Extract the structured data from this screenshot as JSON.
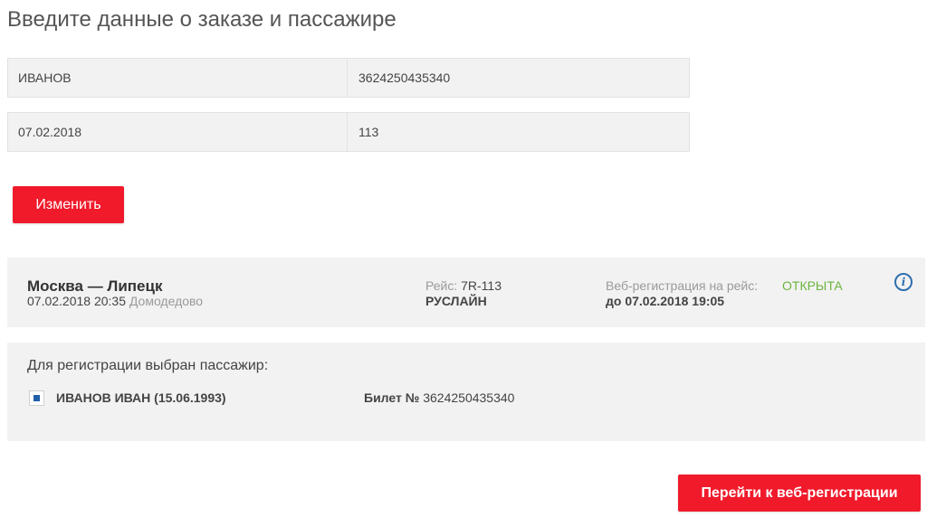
{
  "page": {
    "title": "Введите данные о заказе и пассажире"
  },
  "form": {
    "last_name": "ИВАНОВ",
    "ticket_number": "3624250435340",
    "date": "07.02.2018",
    "flight_number": "113"
  },
  "buttons": {
    "change_label": "Изменить",
    "go_label": "Перейти к веб-регистрации"
  },
  "flight": {
    "route": "Москва — Липецк",
    "departure_datetime": "07.02.2018 20:35",
    "airport": "Домодедово",
    "flight_label": "Рейс:",
    "flight_value": "7R-113",
    "carrier": "РУСЛАЙН",
    "registration_label": "Веб-регистрация на рейс:",
    "registration_status": "ОТКРЫТА",
    "registration_until": "до 07.02.2018 19:05",
    "info_icon": "info-circle-icon",
    "status_color": "#6cb33e"
  },
  "passenger": {
    "heading": "Для регистрации выбран пассажир:",
    "name": "ИВАНОВ ИВАН (15.06.1993)",
    "ticket_label": "Билет №",
    "ticket_number": "3624250435340",
    "selected": true
  },
  "colors": {
    "accent": "#f01a2b",
    "panel_bg": "#f2f2f2",
    "info_blue": "#2f6fb0"
  }
}
